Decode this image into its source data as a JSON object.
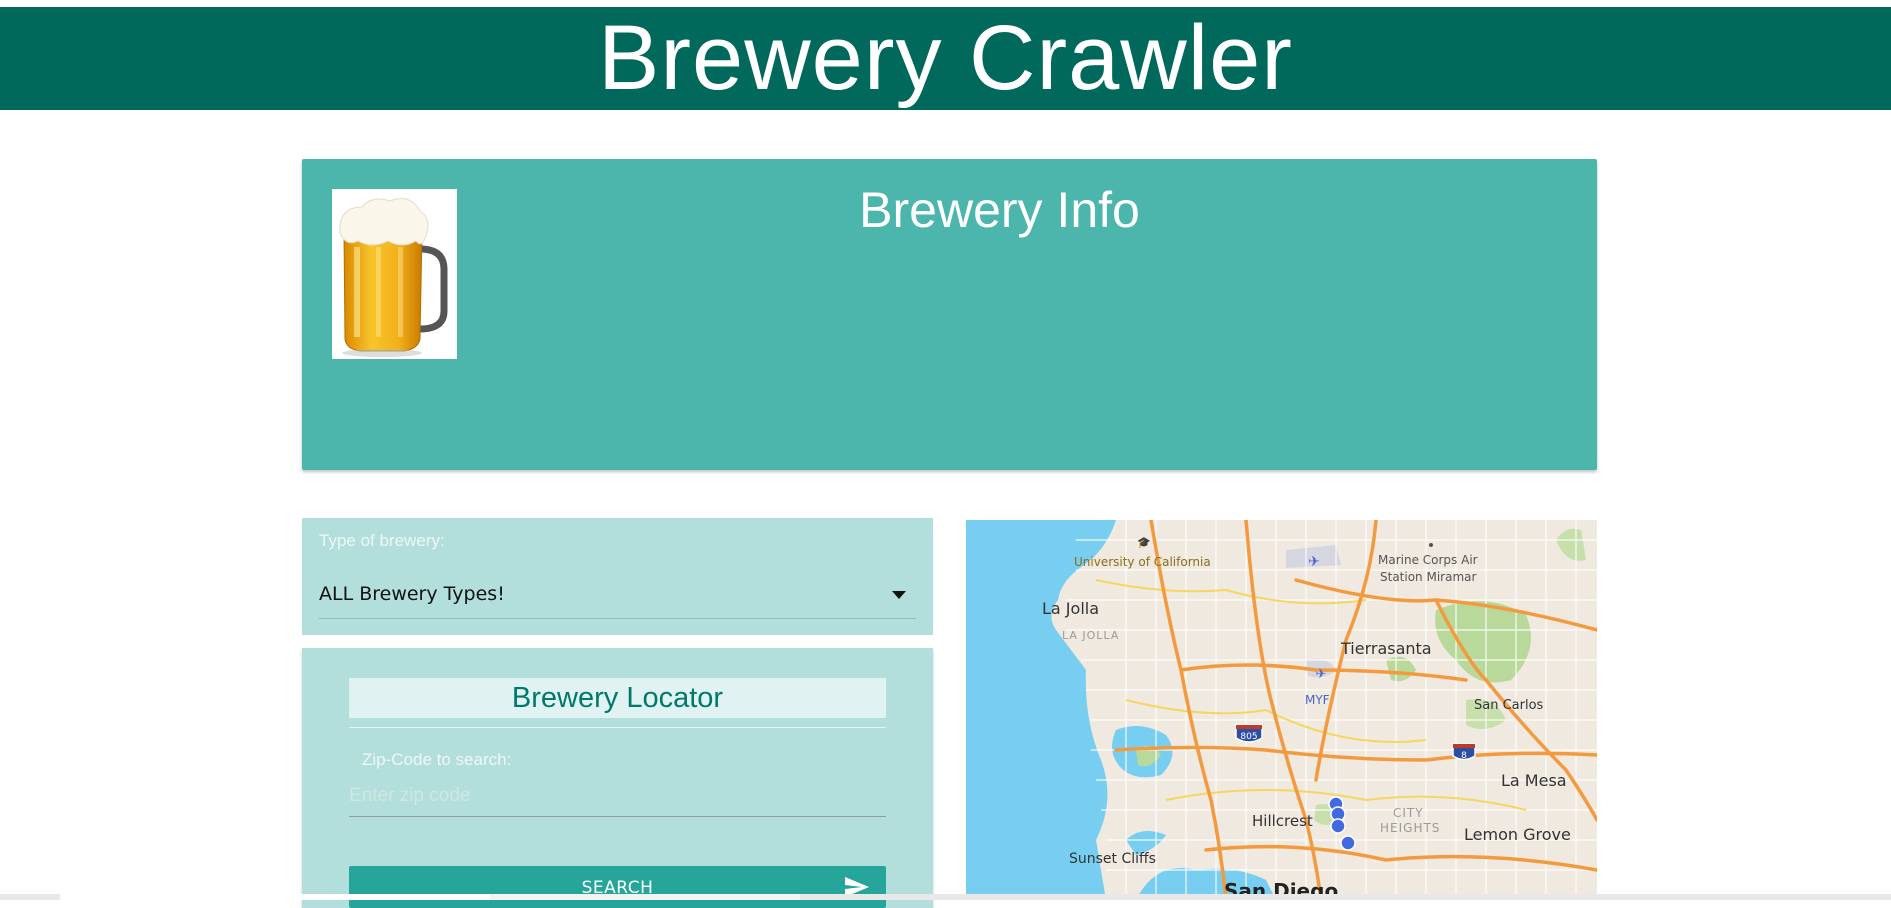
{
  "app": {
    "title": "Brewery Crawler"
  },
  "info_card": {
    "heading": "Brewery Info",
    "image_icon": "beer-mug-icon"
  },
  "filter": {
    "label": "Type of brewery:",
    "selected": "ALL Brewery Types!",
    "icon": "chevron-down-icon"
  },
  "locator": {
    "title": "Brewery Locator",
    "zip_label": "Zip-Code to search:",
    "zip_placeholder": "Enter zip code",
    "zip_value": "",
    "search_label": "SEARCH",
    "search_icon": "send-icon"
  },
  "map": {
    "labels": {
      "uc": "University of California",
      "mcas1": "Marine Corps Air",
      "mcas2": "Station Miramar",
      "lajolla": "La Jolla",
      "lajolla_district": "LA JOLLA",
      "tierrasanta": "Tierrasanta",
      "myf": "MYF",
      "sancarlos": "San Carlos",
      "lamesa": "La Mesa",
      "hillcrest": "Hillcrest",
      "city1": "CITY",
      "city2": "HEIGHTS",
      "lemongrove": "Lemon Grove",
      "sunsetcliffs": "Sunset Cliffs",
      "sandiego": "San Diego"
    },
    "shields": {
      "i805": "805",
      "i8": "8"
    },
    "colors": {
      "water": "#77cef1",
      "land": "#efe9df",
      "highway": "#f39a3e",
      "park": "#b9d99a",
      "marker": "#4169e1"
    }
  }
}
